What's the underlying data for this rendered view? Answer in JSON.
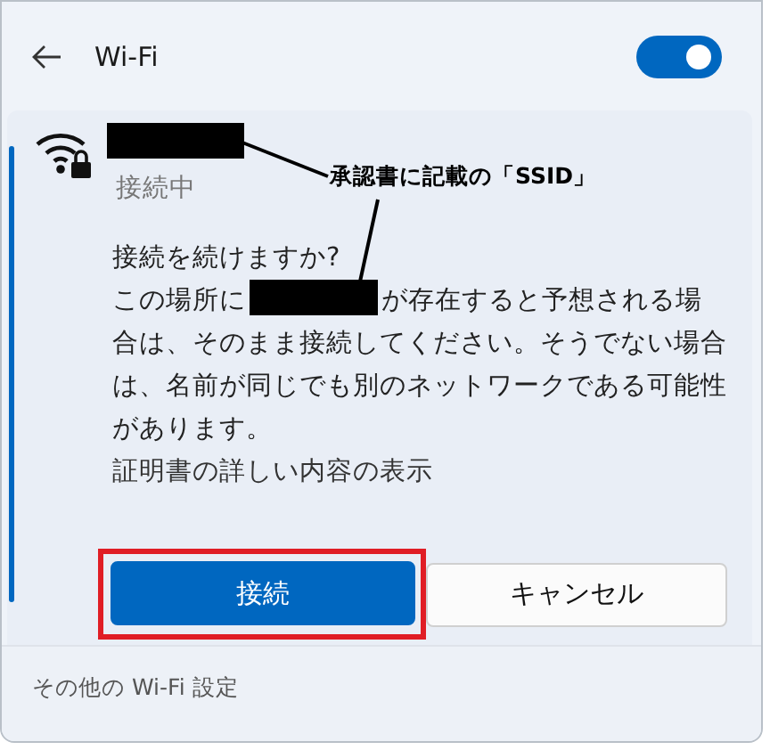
{
  "header": {
    "title": "Wi-Fi",
    "wifi_on": true
  },
  "network": {
    "status": "接続中",
    "prompt": "接続を続けますか?",
    "message_before": "この場所に",
    "message_after": "が存在すると予想される場",
    "message_rest": "合は、そのまま接続してください。そうでない場合は、名前が同じでも別のネットワークである可能性があります。",
    "details_link": "証明書の詳しい内容の表示"
  },
  "annotation": {
    "label": "承認書に記載の「SSID」"
  },
  "buttons": [
    {
      "label": "接続",
      "kind": "primary",
      "highlighted": true
    },
    {
      "label": "キャンセル",
      "kind": "secondary",
      "highlighted": false
    }
  ],
  "footer": {
    "link": "その他の Wi-Fi 設定"
  }
}
